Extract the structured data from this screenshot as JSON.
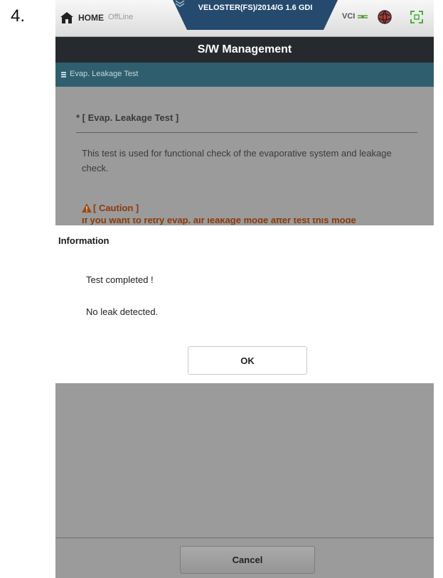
{
  "step_number": "4.",
  "topbar": {
    "home_label": "HOME",
    "status_label": "OffLine",
    "vehicle_label": "VELOSTER(FS)/2014/G 1.6 GDI",
    "vci_label": "VCI",
    "icons": [
      "home-icon",
      "chevron-down-icon",
      "vci-connection-icon",
      "globe-icon",
      "expand-icon"
    ]
  },
  "titlebar": {
    "title": "S/W Management"
  },
  "subheader": {
    "label": "Evap. Leakage Test"
  },
  "content": {
    "section_title": "* [ Evap. Leakage Test ]",
    "description": "This test is used for functional check of the evaporative system and leakage check.",
    "caution_title": "[ Caution ]",
    "caution_text_partial": "If you want to retry evap. air leakage mode after test this mode"
  },
  "dialog": {
    "title": "Information",
    "line1": "Test completed !",
    "line2": "No leak detected.",
    "ok_label": "OK"
  },
  "footer": {
    "cancel_label": "Cancel"
  },
  "colors": {
    "titlebar": "#262a2e",
    "subheader": "#2f5f6e",
    "vehicle_tab": "#254a6e",
    "overlay_gray": "#9b9b9b",
    "caution": "#8a3a0a"
  }
}
